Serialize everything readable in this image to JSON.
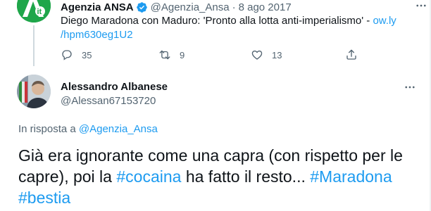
{
  "parent_tweet": {
    "name": "Agenzia ANSA",
    "handle": "@Agenzia_Ansa",
    "separator": "·",
    "date": "8 ago 2017",
    "text": "Diego Maradona con Maduro: 'Pronto alla lotta anti-imperialismo' - ",
    "link_1": "ow.ly",
    "link_2": "/hpm630eg1U2",
    "reply_count": "35",
    "retweet_count": "9",
    "like_count": "13",
    "avatar_text": "Ait",
    "avatar_color": "#1fa64a"
  },
  "tweet": {
    "name": "Alessandro Albanese",
    "handle": "@Alessan67153720",
    "reply_prefix": "In risposta a ",
    "reply_handle": "@Agenzia_Ansa",
    "text_1": "Già era ignorante come una capra (con rispetto per le capre), poi la ",
    "tag_1": "#cocaina",
    "text_2": " ha fatto il resto... ",
    "tag_2": "#Maradona",
    "text_3": " ",
    "tag_3": "#bestia"
  },
  "icons": {
    "reply": "reply-icon",
    "retweet": "retweet-icon",
    "like": "heart-icon",
    "share": "share-icon",
    "more": "more-icon",
    "verified": "verified-badge-icon"
  },
  "colors": {
    "accent": "#1d9bf0",
    "secondary_text": "#536471",
    "primary_text": "#0f1419"
  }
}
